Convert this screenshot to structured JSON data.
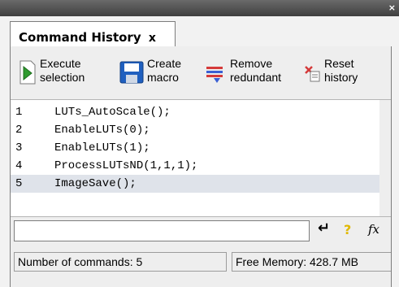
{
  "window": {
    "close_glyph": "×"
  },
  "tab": {
    "label": "Command History",
    "close_glyph": "x"
  },
  "toolbar": {
    "execute": {
      "line1": "Execute",
      "line2": "selection"
    },
    "create": {
      "line1": "Create",
      "line2": "macro"
    },
    "remove": {
      "line1": "Remove",
      "line2": "redundant"
    },
    "reset": {
      "line1": "Reset",
      "line2": "history"
    }
  },
  "history": [
    {
      "num": "1",
      "code": "LUTs_AutoScale();"
    },
    {
      "num": "2",
      "code": "EnableLUTs(0);"
    },
    {
      "num": "3",
      "code": "EnableLUTs(1);"
    },
    {
      "num": "4",
      "code": "ProcessLUTsND(1,1,1);"
    },
    {
      "num": "5",
      "code": "ImageSave();"
    }
  ],
  "command_input": {
    "value": ""
  },
  "cmd_icons": {
    "enter": "enter-icon",
    "help": "help-icon",
    "function": "fx-icon",
    "fx_label": "fx",
    "help_glyph": "?",
    "enter_glyph": "↵"
  },
  "status": {
    "commands": "Number of commands: 5",
    "memory": "Free Memory: 428.7 MB"
  },
  "colors": {
    "selection": "#dfe3ea",
    "accent_green": "#2e9a2e",
    "accent_blue": "#1f5fbf",
    "accent_red": "#d43a3a"
  }
}
